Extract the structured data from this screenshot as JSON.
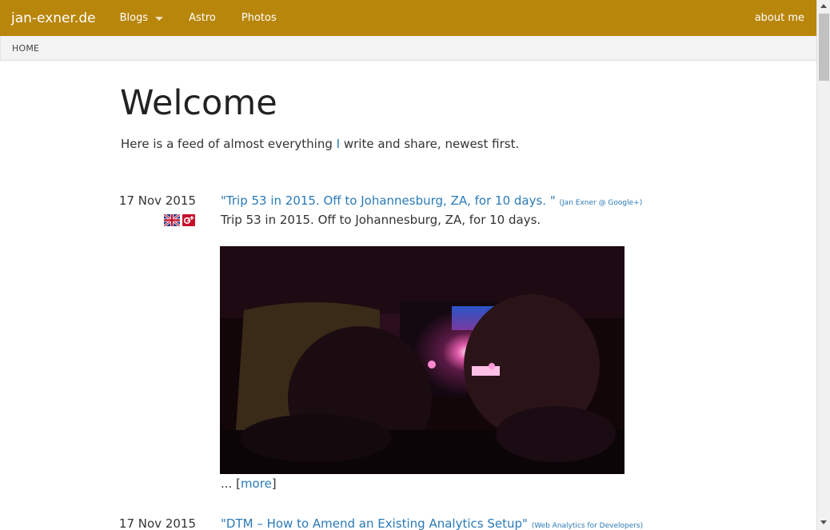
{
  "nav": {
    "brand": "jan-exner.de",
    "items": [
      {
        "label": "Blogs",
        "has_dropdown": true
      },
      {
        "label": "Astro"
      },
      {
        "label": "Photos"
      }
    ],
    "right_label": "about me",
    "bar_color": "#b8860b"
  },
  "breadcrumb": {
    "home": "HOME"
  },
  "main": {
    "title": "Welcome",
    "intro_before": "Here is a feed of almost everything ",
    "intro_link": "I",
    "intro_after": " write and share, newest first."
  },
  "entries": [
    {
      "date": "17 Nov 2015",
      "title": "\"Trip 53 in 2015. Off to Johannesburg, ZA, for 10 days. \"",
      "source": "(Jan Exner @ Google+)",
      "text": "Trip 53 in 2015. Off to Johannesburg, ZA, for 10 days.",
      "icons": [
        "uk-flag-icon",
        "google-plus-icon"
      ],
      "more_prefix": "... [",
      "more_link": "more",
      "more_suffix": "]"
    },
    {
      "date": "17 Nov 2015",
      "title": "\"DTM – How to Amend an Existing Analytics Setup\"",
      "source": "(Web Analytics for Developers)"
    }
  ],
  "link_color": "#2a7ab8"
}
